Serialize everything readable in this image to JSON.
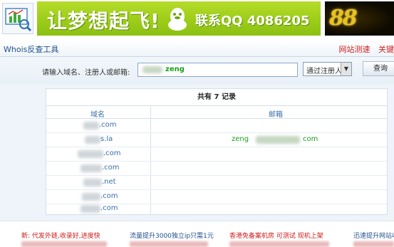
{
  "banner": {
    "slogan": "让梦想起飞!",
    "contact": "联系QQ 4086205",
    "gold_mark": "88",
    "colors": {
      "ad_green": "#9ccd19",
      "gold": "#e8c21e"
    },
    "icons": {
      "logo": "chart-magnifier-icon",
      "qq": "qq-penguin-icon"
    }
  },
  "nav": {
    "title": "Whois反查工具",
    "links": [
      "网站测速",
      "关键"
    ]
  },
  "search": {
    "label": "请输入域名、注册人或邮箱:",
    "value": "zeng",
    "select_value": "通过注册人",
    "button": "查询"
  },
  "result": {
    "count_text": "共有 7 记录",
    "columns": [
      "域名",
      "邮箱"
    ],
    "rows": [
      {
        "domain": ".com",
        "email": ""
      },
      {
        "domain": "s.la",
        "email": "zeng"
      },
      {
        "domain": ".com",
        "email": ""
      },
      {
        "domain": ".com",
        "email": ""
      },
      {
        "domain": ".net",
        "email": ""
      },
      {
        "domain": ".com",
        "email": ""
      },
      {
        "domain": ".com",
        "email": ""
      }
    ],
    "email_suffix": "com",
    "colors": {
      "link": "#3a6ea8",
      "email": "#1aa01a"
    }
  },
  "footer": {
    "ads": [
      "新: 代发外链,收录好,进度快",
      "流量提升3000独立ip只需1元",
      "香港免备案机房  可测试  现机上架",
      "迅速提升网站收"
    ]
  }
}
